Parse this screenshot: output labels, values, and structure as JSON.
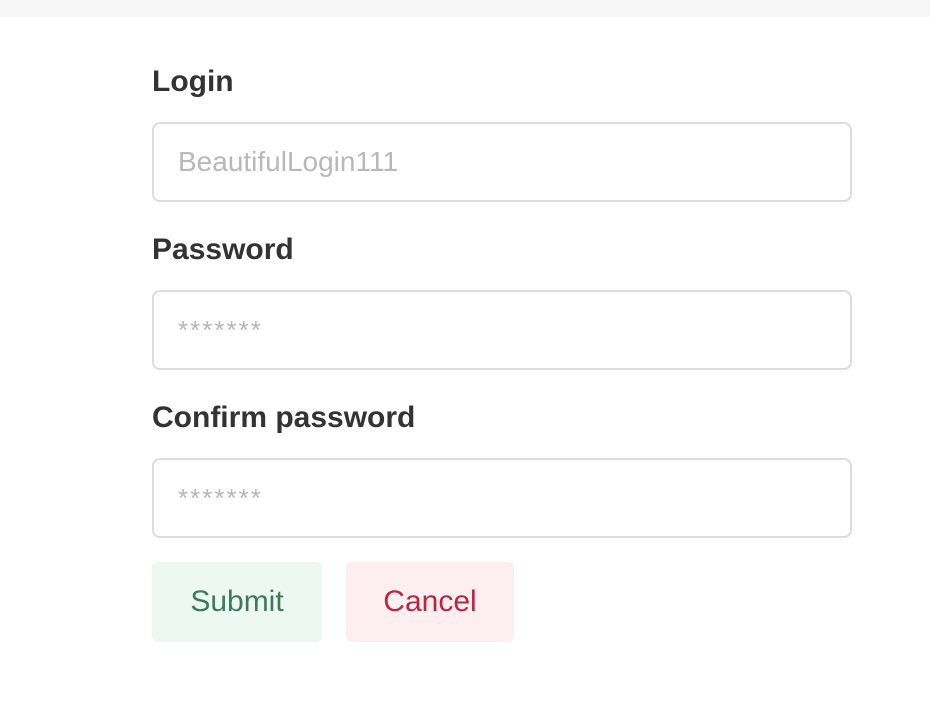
{
  "form": {
    "login": {
      "label": "Login",
      "placeholder": "BeautifulLogin111",
      "value": ""
    },
    "password": {
      "label": "Password",
      "placeholder": "*******",
      "value": ""
    },
    "confirm_password": {
      "label": "Confirm password",
      "placeholder": "*******",
      "value": ""
    },
    "buttons": {
      "submit_label": "Submit",
      "cancel_label": "Cancel"
    }
  },
  "colors": {
    "submit_bg": "#eef8f2",
    "submit_text": "#3e7a5a",
    "cancel_bg": "#fceef1",
    "cancel_text": "#b7283f",
    "label_text": "#333333",
    "placeholder_text": "#b8b8b8",
    "field_border": "#dcdcdc"
  }
}
